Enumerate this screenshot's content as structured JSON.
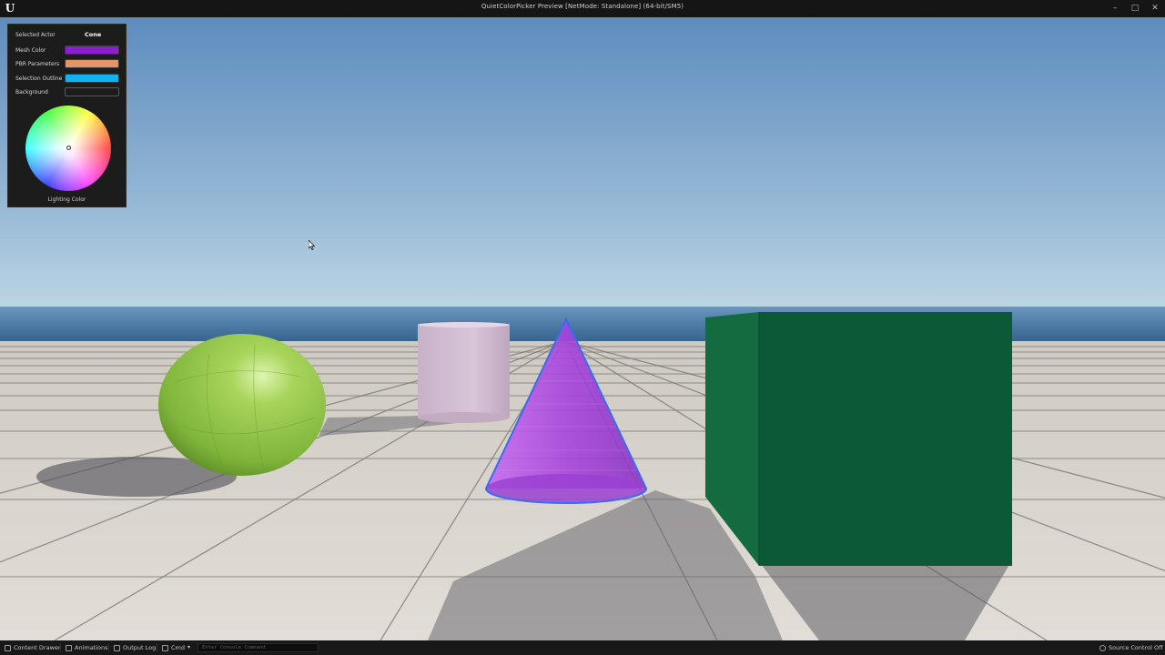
{
  "window": {
    "title": "QuietColorPicker Preview [NetMode: Standalone]  (64-bit/SM5)",
    "logo_icon": "unreal-logo-icon",
    "controls": [
      "minimize-icon",
      "maximize-icon",
      "close-icon"
    ]
  },
  "picker": {
    "selected_actor_label": "Selected Actor",
    "selected_actor_value": "Cone",
    "rows": [
      {
        "label": "Mesh Color",
        "color": "#8a1fd0"
      },
      {
        "label": "PBR Parameters",
        "color": "#e0956a"
      },
      {
        "label": "Selection Outline",
        "color": "#12b2f0"
      },
      {
        "label": "Background",
        "color": "#1c1c1c"
      }
    ],
    "wheel_label": "Lighting Color"
  },
  "scene": {
    "sky_top": "#5f8fbf",
    "sky_horizon": "#b8d2e3",
    "ocean": "#3f6f9f",
    "floor": "#d8d4cc",
    "sphere_color": "#95c94a",
    "cylinder_color": "#d2bcd2",
    "cone_color": "#a34bd8",
    "cone_outline": "#3a6cf0",
    "cube_front": "#0c5a35",
    "cube_side": "#136a3f"
  },
  "statusbar": {
    "content_drawer": "Content Drawer",
    "animations": "Animations",
    "output_log": "Output Log",
    "cmd": "Cmd",
    "console_placeholder": "Enter Console Command",
    "source_control": "Source Control Off"
  }
}
